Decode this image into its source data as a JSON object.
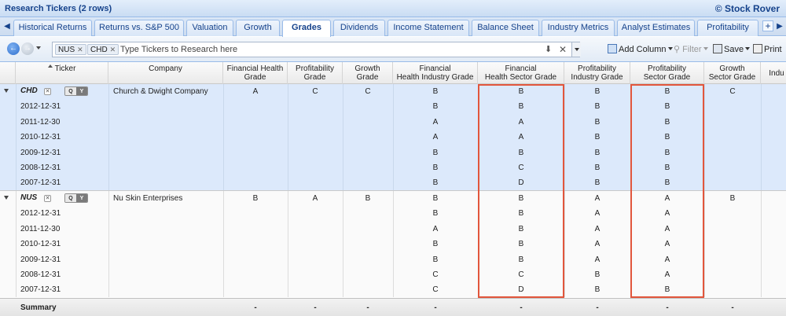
{
  "titlebar": {
    "title": "Research Tickers (2 rows)",
    "brand": "© Stock Rover"
  },
  "tabs": [
    "Historical Returns",
    "Returns vs. S&P 500",
    "Valuation",
    "Growth",
    "Grades",
    "Dividends",
    "Income Statement",
    "Balance Sheet",
    "Industry Metrics",
    "Analyst Estimates",
    "Profitability"
  ],
  "active_tab": "Grades",
  "toolbar": {
    "chips": [
      "NUS",
      "CHD"
    ],
    "search_placeholder": "Type Tickers to Research here",
    "add_column": "Add Column",
    "filter": "Filter",
    "save": "Save",
    "print": "Print"
  },
  "columns": [
    "Ticker",
    "Company",
    "Financial Health\nGrade",
    "Profitability\nGrade",
    "Growth\nGrade",
    "Financial\nHealth Industry Grade",
    "Financial\nHealth Sector Grade",
    "Profitability\nIndustry Grade",
    "Profitability\nSector Grade",
    "Growth\nSector Grade",
    "Indu"
  ],
  "groups": [
    {
      "ticker": "CHD",
      "company": "Church & Dwight Company",
      "current": {
        "fh": "A",
        "prof": "C",
        "growth": "C",
        "fhi": "B",
        "fhs": "B",
        "pi": "B",
        "ps": "B",
        "gs": "C"
      },
      "history": [
        {
          "date": "2012-12-31",
          "fhi": "B",
          "fhs": "B",
          "pi": "B",
          "ps": "B"
        },
        {
          "date": "2011-12-30",
          "fhi": "A",
          "fhs": "A",
          "pi": "B",
          "ps": "B"
        },
        {
          "date": "2010-12-31",
          "fhi": "A",
          "fhs": "A",
          "pi": "B",
          "ps": "B"
        },
        {
          "date": "2009-12-31",
          "fhi": "B",
          "fhs": "B",
          "pi": "B",
          "ps": "B"
        },
        {
          "date": "2008-12-31",
          "fhi": "B",
          "fhs": "C",
          "pi": "B",
          "ps": "B"
        },
        {
          "date": "2007-12-31",
          "fhi": "B",
          "fhs": "D",
          "pi": "B",
          "ps": "B"
        }
      ]
    },
    {
      "ticker": "NUS",
      "company": "Nu Skin Enterprises",
      "current": {
        "fh": "B",
        "prof": "A",
        "growth": "B",
        "fhi": "B",
        "fhs": "B",
        "pi": "A",
        "ps": "A",
        "gs": "B"
      },
      "history": [
        {
          "date": "2012-12-31",
          "fhi": "B",
          "fhs": "B",
          "pi": "A",
          "ps": "A"
        },
        {
          "date": "2011-12-30",
          "fhi": "A",
          "fhs": "B",
          "pi": "A",
          "ps": "A"
        },
        {
          "date": "2010-12-31",
          "fhi": "B",
          "fhs": "B",
          "pi": "A",
          "ps": "A"
        },
        {
          "date": "2009-12-31",
          "fhi": "B",
          "fhs": "B",
          "pi": "A",
          "ps": "A"
        },
        {
          "date": "2008-12-31",
          "fhi": "C",
          "fhs": "C",
          "pi": "B",
          "ps": "A"
        },
        {
          "date": "2007-12-31",
          "fhi": "C",
          "fhs": "D",
          "pi": "B",
          "ps": "B"
        }
      ]
    }
  ],
  "summary": {
    "label": "Summary",
    "value": "-"
  },
  "colors": {
    "highlight": "#e2563c",
    "selected_group": "#dce9fb",
    "title_text": "#15428b"
  }
}
